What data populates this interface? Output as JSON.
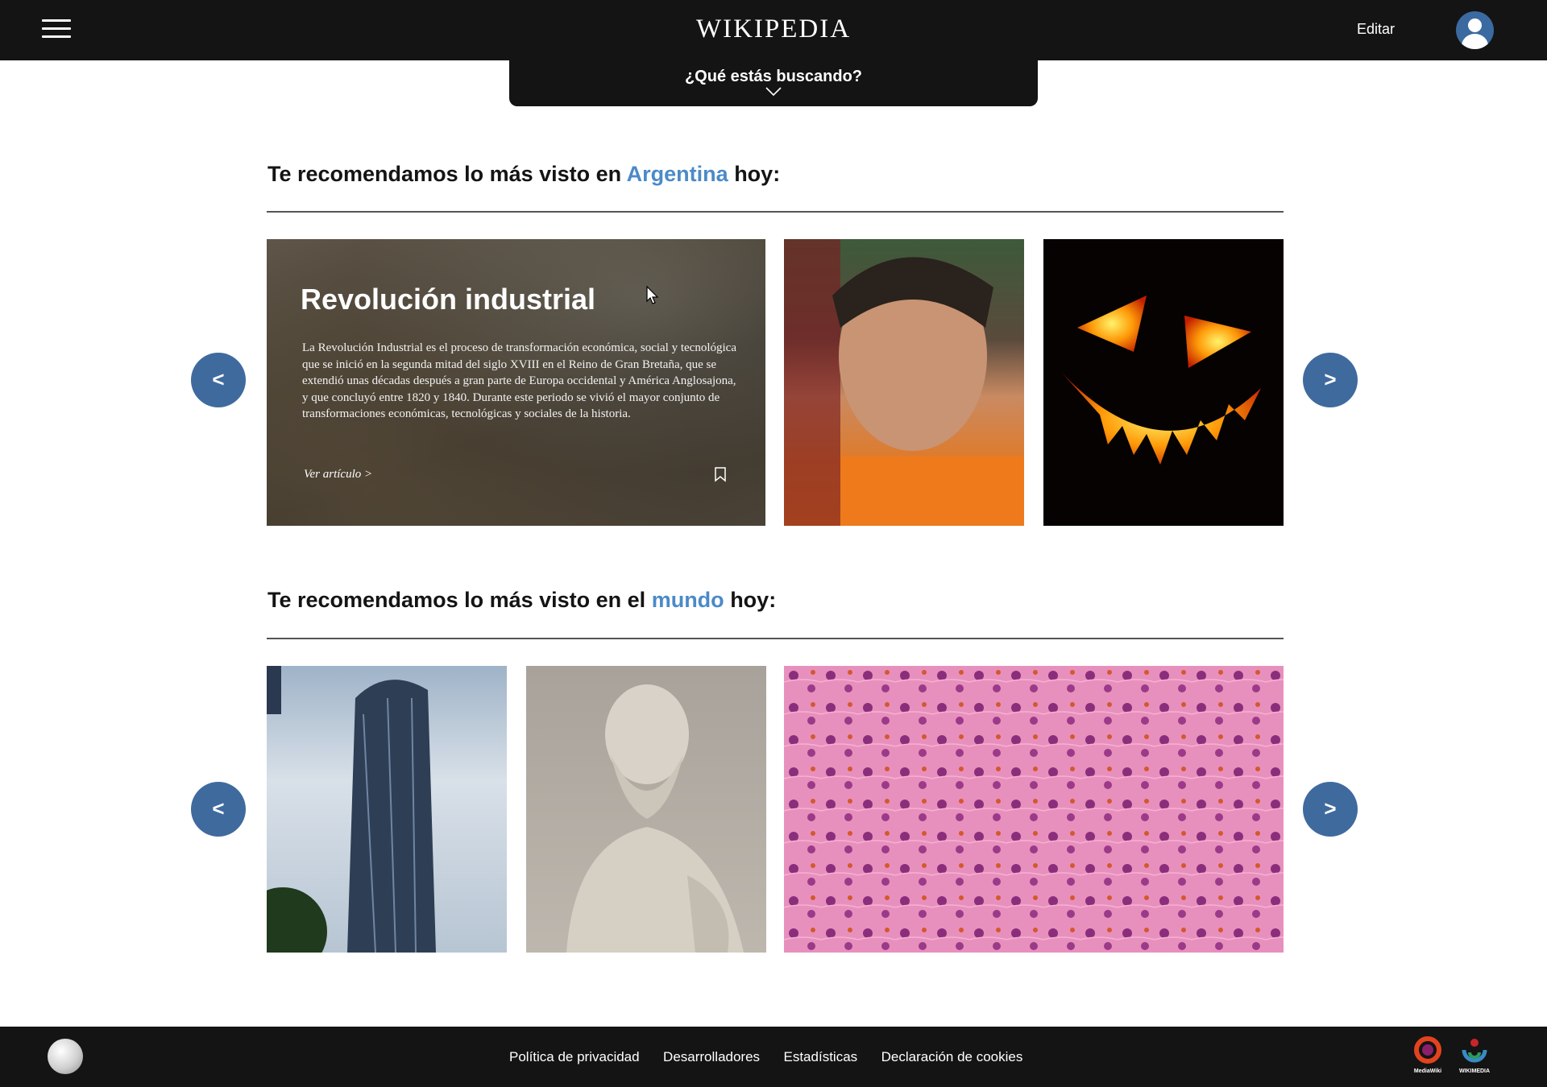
{
  "header": {
    "logo_text": "WIKIPEDIA",
    "edit_label": "Editar",
    "search_prompt": "¿Qué estás buscando?"
  },
  "sections": [
    {
      "title_prefix": "Te recomendamos lo más visto en",
      "title_highlight": "Argentina",
      "title_suffix": "hoy:",
      "featured": {
        "title": "Revolución industrial",
        "description": "La Revolución Industrial es el proceso de transformación económica, social y tecnológica que se inició en la segunda mitad del siglo XVIII en el Reino de Gran Bretaña, que se extendió unas décadas después a gran parte de Europa occidental y América Anglosajona, y que concluyó entre 1820 y 1840. Durante este periodo se vivió el mayor conjunto de transformaciones económicas, tecnológicas y sociales de la historia.",
        "link_label": "Ver artículo >"
      },
      "prev_label": "<",
      "next_label": ">"
    },
    {
      "title_prefix": "Te recomendamos lo más visto en el",
      "title_highlight": "mundo",
      "title_suffix": "hoy:",
      "prev_label": "<",
      "next_label": ">"
    }
  ],
  "footer": {
    "links": [
      "Política de privacidad",
      "Desarrolladores",
      "Estadísticas",
      "Declaración de cookies"
    ],
    "mediawiki_label": "MediaWiki",
    "wikimedia_label": "WIKIMEDIA"
  },
  "colors": {
    "accent": "#4b8ac8",
    "arrow_bg": "#3f6a9e",
    "bar_bg": "#141414"
  }
}
